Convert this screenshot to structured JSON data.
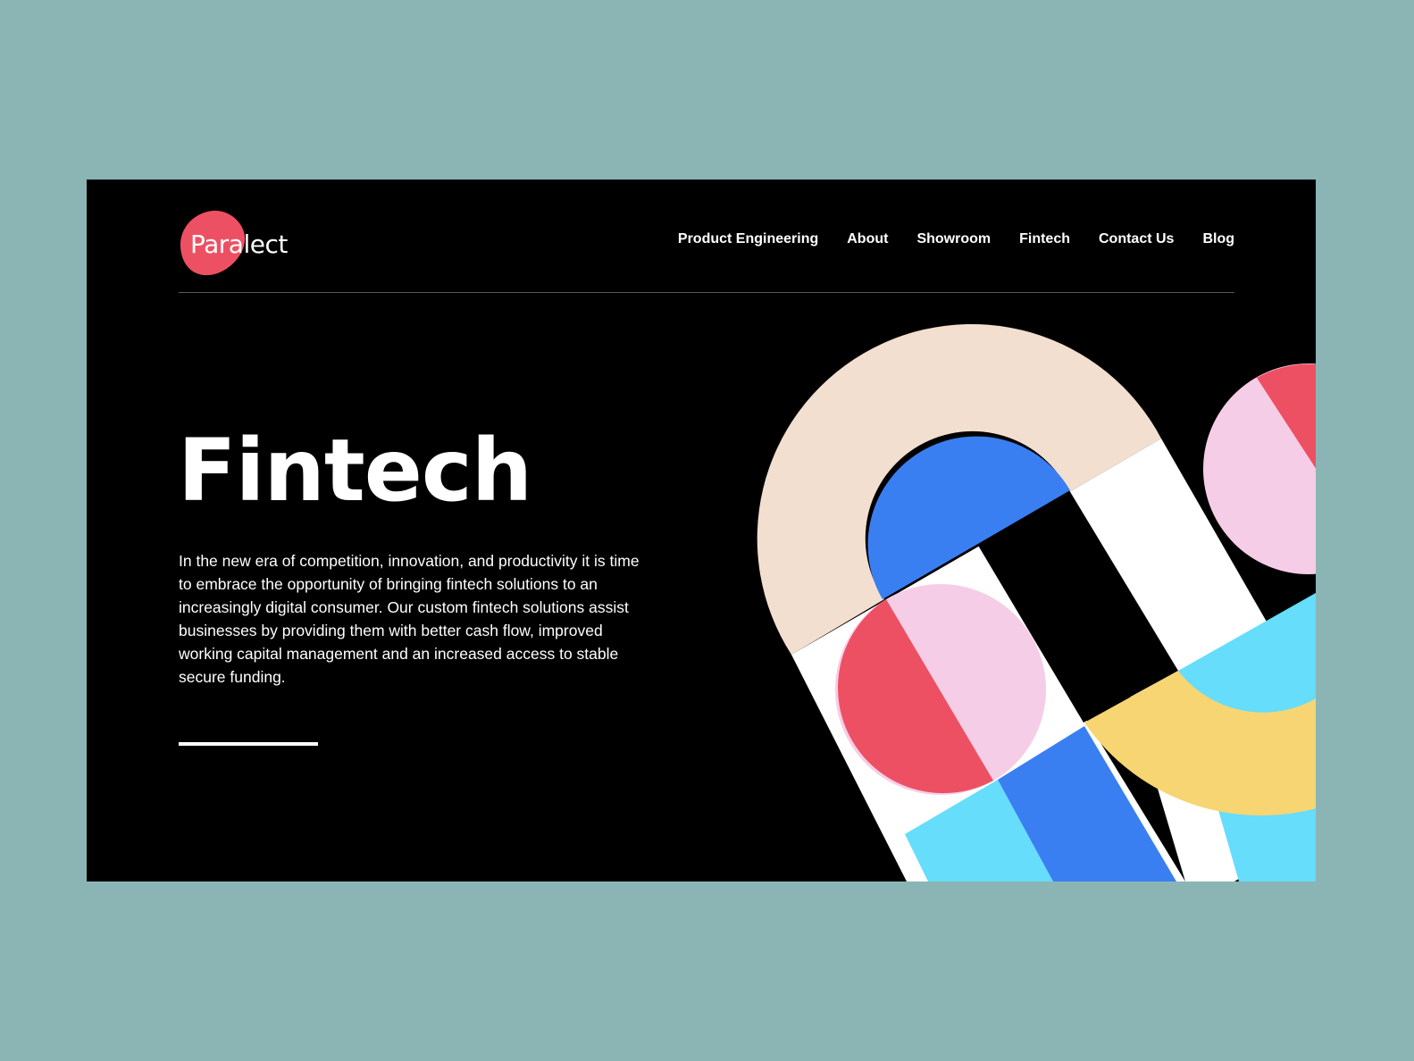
{
  "brand": {
    "name": "Paralect",
    "accent": "#ed5063"
  },
  "nav": {
    "items": [
      {
        "label": "Product Engineering"
      },
      {
        "label": "About"
      },
      {
        "label": "Showroom"
      },
      {
        "label": "Fintech"
      },
      {
        "label": "Contact Us"
      },
      {
        "label": "Blog"
      }
    ]
  },
  "hero": {
    "title": "Fintech",
    "description": "In the new era of competition, innovation, and productivity it is time to embrace the opportunity of bringing fintech solutions to an increasingly digital consumer. Our custom fintech solutions assist businesses by providing them with better cash flow, improved working capital management and an increased access to stable secure funding."
  },
  "colors": {
    "background": "#8bb5b5",
    "page": "#000000",
    "beige": "#f2dfd0",
    "blue": "#3a7ff1",
    "pink": "#f6cde6",
    "red": "#ed5063",
    "cyan": "#66ddfb",
    "yellow": "#f7d572",
    "white": "#ffffff"
  }
}
